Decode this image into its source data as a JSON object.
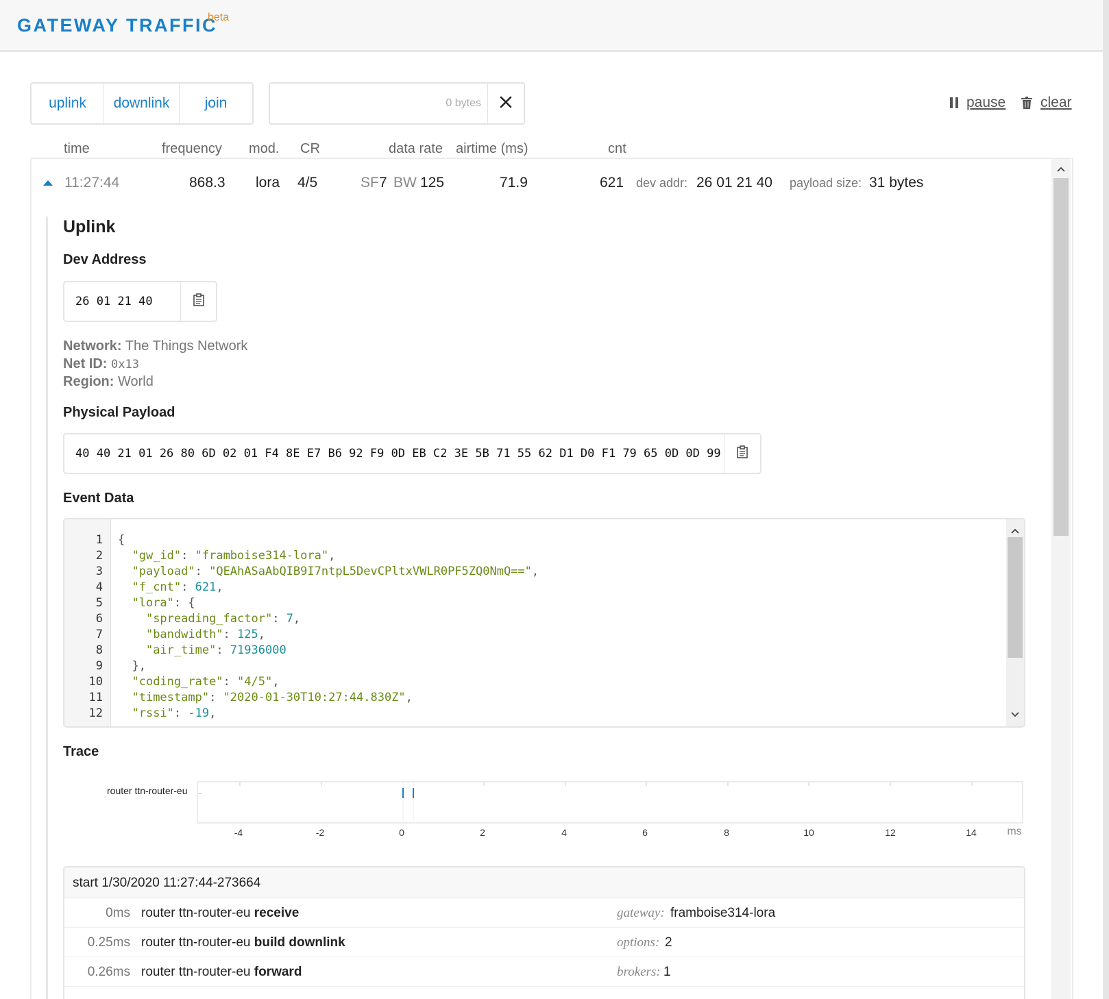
{
  "header": {
    "title": "GATEWAY TRAFFIC",
    "badge": "beta"
  },
  "filters": {
    "uplink": "uplink",
    "downlink": "downlink",
    "join": "join"
  },
  "search": {
    "placeholder": "0 bytes"
  },
  "toolbar": {
    "pause": "pause",
    "clear": "clear"
  },
  "columns": {
    "time": "time",
    "frequency": "frequency",
    "mod": "mod.",
    "cr": "CR",
    "data_rate": "data rate",
    "airtime": "airtime (ms)",
    "cnt": "cnt"
  },
  "row": {
    "time": "11:27:44",
    "frequency": "868.3",
    "mod": "lora",
    "cr": "4/5",
    "sf_label": "SF",
    "sf": "7",
    "bw_label": "BW",
    "bw": "125",
    "airtime": "71.9",
    "cnt": "621",
    "dev_addr_label": "dev addr:",
    "dev_addr": "26 01 21 40",
    "payload_size_label": "payload size:",
    "payload_size": "31 bytes"
  },
  "detail": {
    "title": "Uplink",
    "dev_address_heading": "Dev Address",
    "dev_address": "26 01 21 40",
    "network_label": "Network:",
    "network": "The Things Network",
    "netid_label": "Net ID:",
    "netid": "0x13",
    "region_label": "Region:",
    "region": "World",
    "payload_heading": "Physical Payload",
    "payload": "40 40 21 01 26 80 6D 02 01 F4 8E E7 B6 92 F9 0D EB C2 3E 5B 71 55 62 D1 D0 F1 79 65 0D 0D 99",
    "event_heading": "Event Data",
    "trace_heading": "Trace"
  },
  "event_data": {
    "line_numbers": [
      "1",
      "2",
      "3",
      "4",
      "5",
      "6",
      "7",
      "8",
      "9",
      "10",
      "11",
      "12"
    ],
    "l1": "{",
    "gw_id_key": "\"gw_id\"",
    "gw_id_val": "\"framboise314-lora\"",
    "payload_key": "\"payload\"",
    "payload_val": "\"QEAhASaAbQIB9I7ntpL5DevCPltxVWLR0PF5ZQ0NmQ==\"",
    "f_cnt_key": "\"f_cnt\"",
    "f_cnt_val": "621",
    "lora_key": "\"lora\"",
    "sf_key": "\"spreading_factor\"",
    "sf_val": "7",
    "bw_key": "\"bandwidth\"",
    "bw_val": "125",
    "air_key": "\"air_time\"",
    "air_val": "71936000",
    "close": "},",
    "cr_key": "\"coding_rate\"",
    "cr_val": "\"4/5\"",
    "ts_key": "\"timestamp\"",
    "ts_val": "\"2020-01-30T10:27:44.830Z\"",
    "rssi_key": "\"rssi\"",
    "rssi_val": "-19"
  },
  "trace": {
    "row_label": "router ttn-router-eu",
    "ticks": [
      "-4",
      "-2",
      "0",
      "2",
      "4",
      "6",
      "8",
      "10",
      "12",
      "14"
    ],
    "unit": "ms",
    "start": "start 1/30/2020 11:27:44-273664",
    "events": [
      {
        "ms": "0ms",
        "service": "router ttn-router-eu",
        "event": "receive",
        "key": "gateway:",
        "value": "framboise314-lora"
      },
      {
        "ms": "0.25ms",
        "service": "router ttn-router-eu",
        "event": "build downlink",
        "key": "options:",
        "value": "2"
      },
      {
        "ms": "0.26ms",
        "service": "router ttn-router-eu",
        "event": "forward",
        "key": "brokers:",
        "value": "1"
      }
    ]
  },
  "icons": {
    "pause": "pause-icon",
    "trash": "trash-icon",
    "close": "close-icon",
    "clipboard": "clipboard-icon",
    "caret": "caret-up-icon"
  },
  "colors": {
    "accent": "#1a7fc9",
    "beta": "#e08a2a",
    "json_string": "#6a8a16",
    "json_number": "#1a8f9a"
  }
}
